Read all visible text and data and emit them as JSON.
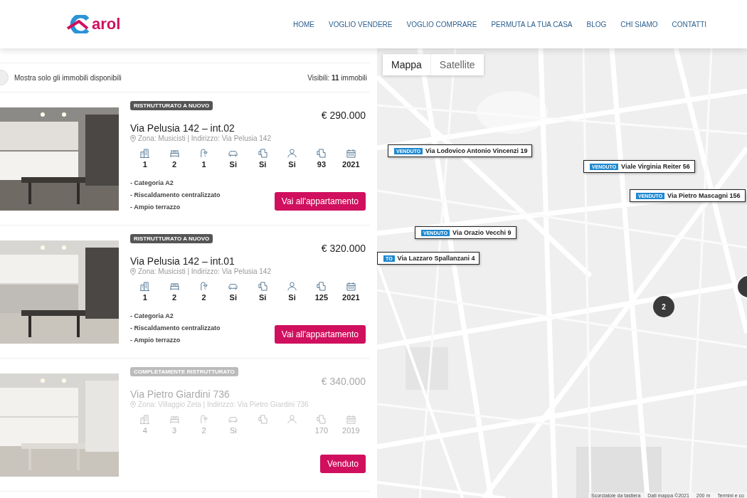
{
  "header": {
    "logo": {
      "text": "arol"
    },
    "nav": [
      {
        "label": "HOME"
      },
      {
        "label": "VOGLIO VENDERE"
      },
      {
        "label": "VOGLIO COMPRARE"
      },
      {
        "label": "PERMUTA LA TUA CASA"
      },
      {
        "label": "BLOG"
      },
      {
        "label": "CHI SIAMO"
      },
      {
        "label": "CONTATTI"
      }
    ]
  },
  "filter": {
    "toggle_on": false,
    "label": "Mostra solo gli immobili disponibili",
    "visible_text": "Visibili: **11** immobili"
  },
  "listings": [
    {
      "sold": false,
      "badge": "RISTRUTTURATO A NUOVO",
      "price": "€ 290.000",
      "title": "Via Pelusia 142 – int.02",
      "address": "Zona: Musicisti | Indirizzo: Via Pelusia 142",
      "features": [
        {
          "kind": "building",
          "value": "1"
        },
        {
          "kind": "bed",
          "value": "2"
        },
        {
          "kind": "shower",
          "value": "1"
        },
        {
          "kind": "car",
          "value": "Si"
        },
        {
          "kind": "plan",
          "value": "Si"
        },
        {
          "kind": "person",
          "value": "Si"
        },
        {
          "kind": "plan",
          "value": "93"
        },
        {
          "kind": "calendar",
          "value": "2021"
        }
      ],
      "notes": [
        "- Categoria A2",
        "- Riscaldamento centralizzato",
        "- Ampio terrazzo"
      ],
      "button": "Vai all'appartamento"
    },
    {
      "sold": false,
      "badge": "RISTRUTTURATO A NUOVO",
      "price": "€ 320.000",
      "title": "Via Pelusia 142 – int.01",
      "address": "Zona: Musicisti | Indirizzo: Via Pelusia 142",
      "features": [
        {
          "kind": "building",
          "value": "1"
        },
        {
          "kind": "bed",
          "value": "2"
        },
        {
          "kind": "shower",
          "value": "2"
        },
        {
          "kind": "car",
          "value": "Si"
        },
        {
          "kind": "plan",
          "value": "Si"
        },
        {
          "kind": "person",
          "value": "Si"
        },
        {
          "kind": "plan",
          "value": "125"
        },
        {
          "kind": "calendar",
          "value": "2021"
        }
      ],
      "notes": [
        "- Categoria A2",
        "- Riscaldamento centralizzato",
        "- Ampio terrazzo"
      ],
      "button": "Vai all'appartamento"
    },
    {
      "sold": true,
      "badge": "COMPLETAMENTE RISTRUTTURATO",
      "price": "€ 340.000",
      "title": "Via Pietro Giardini 736",
      "address": "Zona: Villaggio Zeta | Indirizzo: Via Pietro Giardini 736",
      "features": [
        {
          "kind": "building",
          "value": "4"
        },
        {
          "kind": "bed",
          "value": "3"
        },
        {
          "kind": "shower",
          "value": "2"
        },
        {
          "kind": "car",
          "value": "Si"
        },
        {
          "kind": "plan"
        },
        {
          "kind": "person"
        },
        {
          "kind": "plan",
          "value": "170"
        },
        {
          "kind": "calendar",
          "value": "2019"
        }
      ],
      "button": "Venduto"
    }
  ],
  "map": {
    "kind": "picture",
    "types": [
      {
        "label": "Mappa",
        "selected": true
      },
      {
        "label": "Satellite",
        "selected": false
      }
    ],
    "markers": [
      {
        "badge": "VENDUTO",
        "label": "Via Lodovico Antonio Vincenzi 19"
      },
      {
        "badge": "VENDUTO",
        "label": "Viale Virginia Reiter 56"
      },
      {
        "badge": "VENDUTO",
        "label": "Via Pietro Mascagni 156"
      },
      {
        "badge": "VENDUTO",
        "label": "Via Orazio Vecchi 9"
      },
      {
        "badge": "TO",
        "label": "Via Lazzaro Spallanzani 4"
      }
    ],
    "clusters": [
      {
        "label": "2",
        "partial": false
      },
      {
        "partial": true
      }
    ],
    "attribution": [
      "Scorciatoie da tastiera",
      "Dati mappa ©2021",
      "200 m",
      "Termini e co"
    ]
  }
}
